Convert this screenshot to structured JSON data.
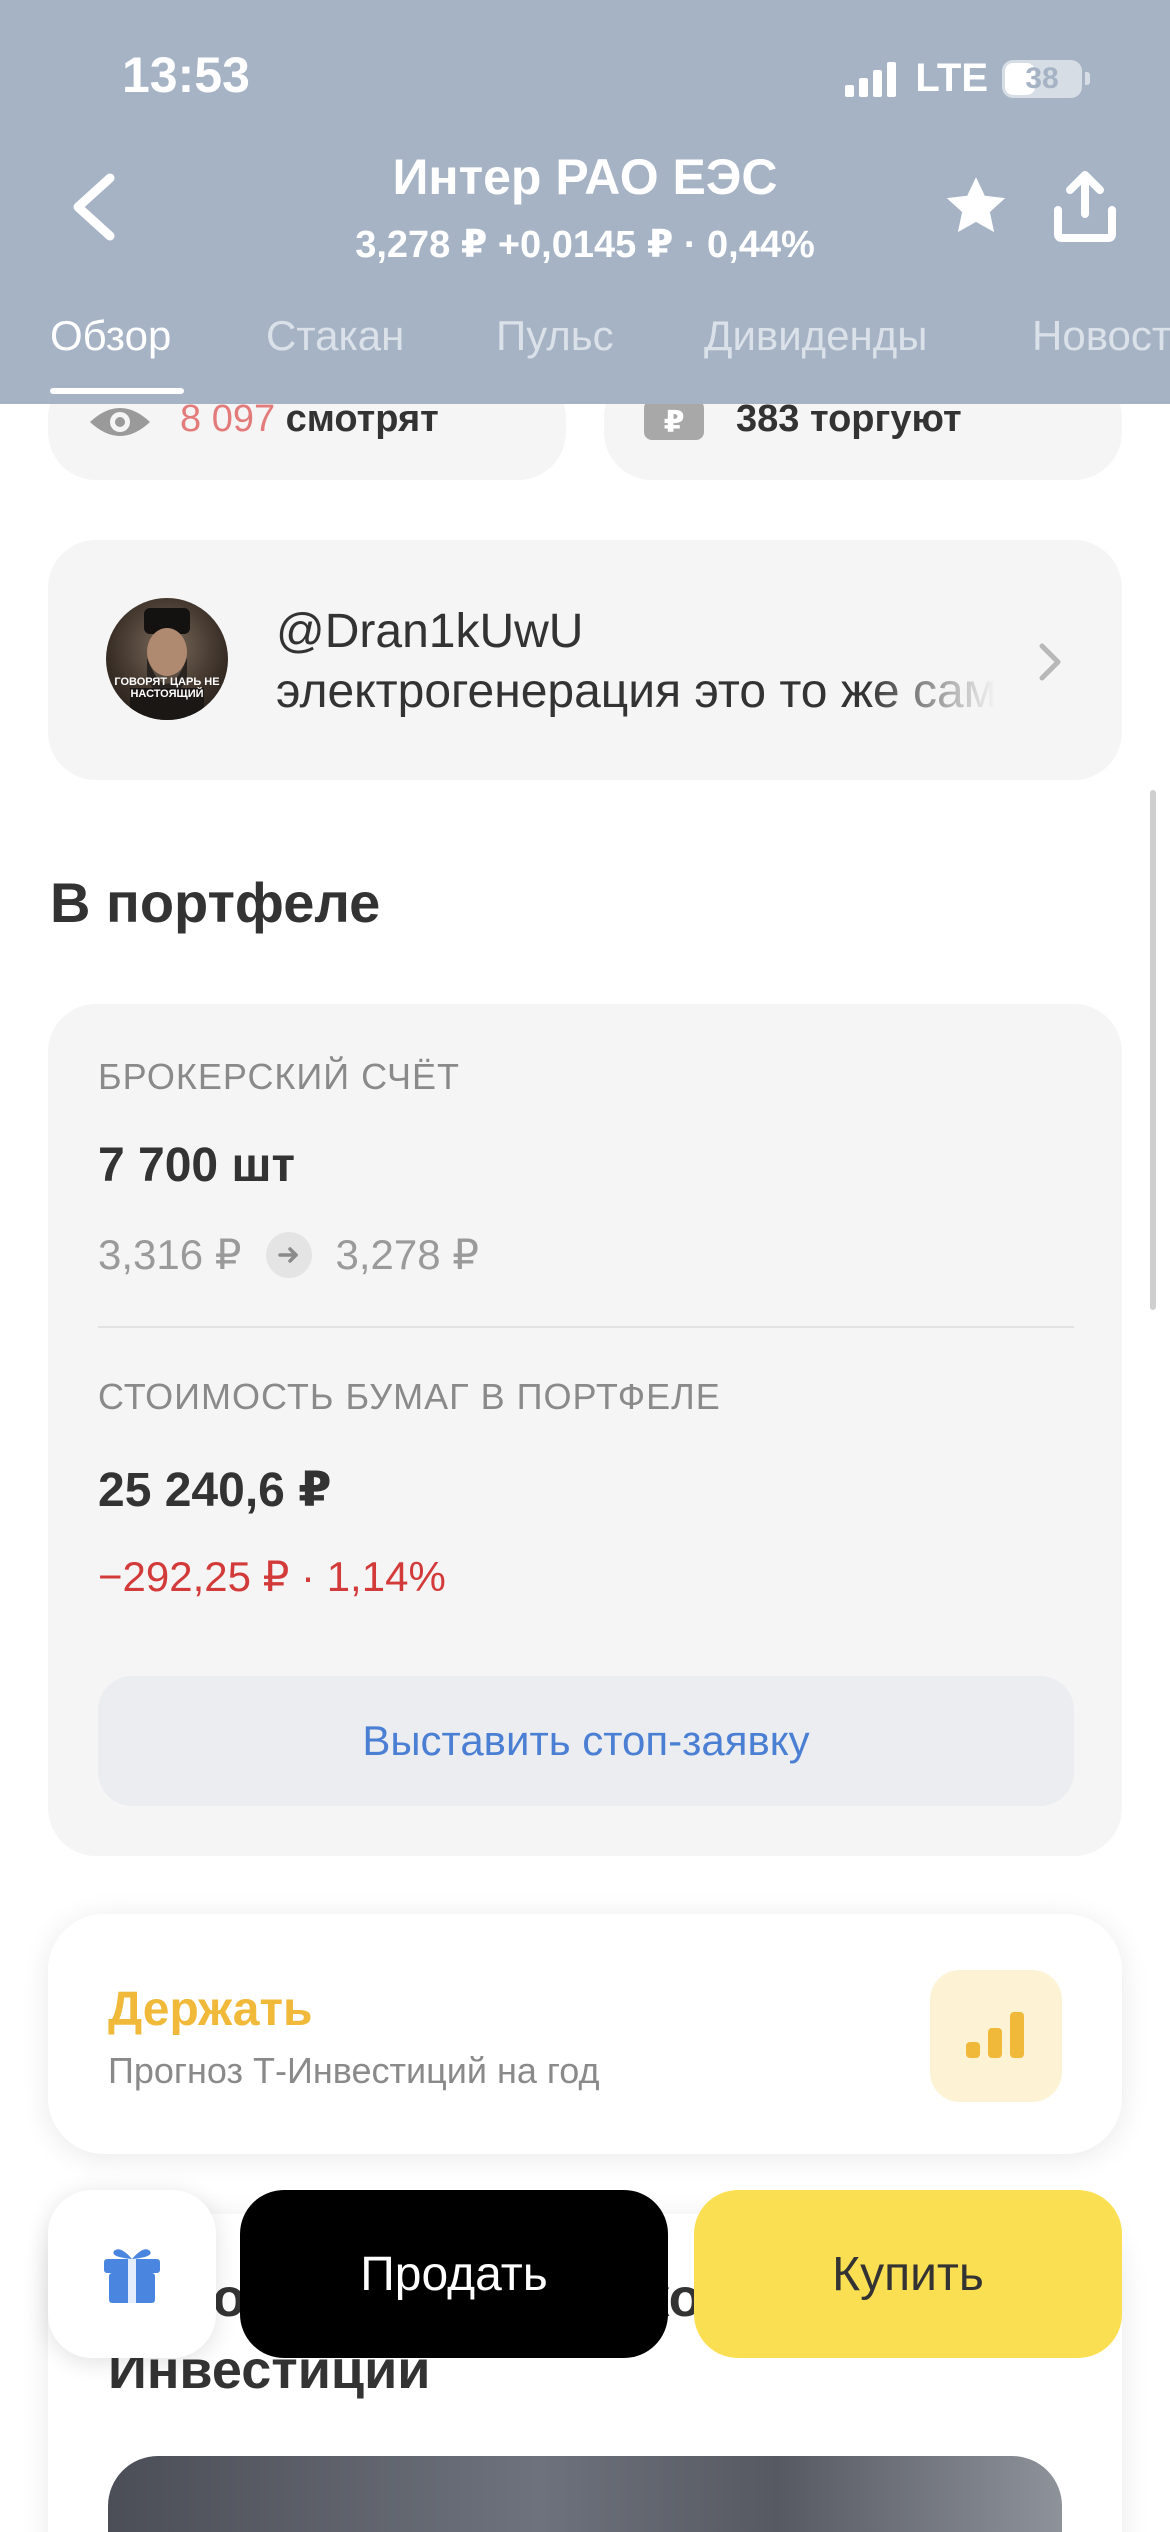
{
  "status_bar": {
    "time": "13:53",
    "network": "LTE",
    "battery": "38"
  },
  "header": {
    "title": "Интер РАО ЕЭС",
    "quote": "3,278 ₽  +0,0145 ₽ · 0,44%",
    "back_icon": "chevron-left-icon",
    "favorite_icon": "star-icon",
    "share_icon": "share-icon"
  },
  "tabs": [
    {
      "label": "Обзор",
      "active": true
    },
    {
      "label": "Стакан",
      "active": false
    },
    {
      "label": "Пульс",
      "active": false
    },
    {
      "label": "Дивиденды",
      "active": false
    },
    {
      "label": "Новости",
      "active": false
    }
  ],
  "stats": {
    "watching_count": "8 097",
    "watching_label": "смотрят",
    "trading_label": "383 торгуют"
  },
  "pulse_post": {
    "username": "@Dran1kUwU",
    "text": "электрогенерация это то же самое",
    "avatar_caption": "ГОВОРЯТ ЦАРЬ НЕ НАСТОЯЩИЙ"
  },
  "portfolio": {
    "section_title": "В портфеле",
    "account_label": "БРОКЕРСКИЙ СЧЁТ",
    "quantity": "7 700 шт",
    "avg_price": "3,316 ₽",
    "current_price": "3,278 ₽",
    "value_label": "СТОИМОСТЬ БУМАГ В ПОРТФЕЛЕ",
    "value": "25 240,6 ₽",
    "change": "−292,25 ₽ · 1,14%",
    "stop_order_button": "Выставить стоп-заявку"
  },
  "forecast": {
    "title": "Держать",
    "subtitle": "Прогноз Т-Инвестиций на год",
    "color": "#f0b93a"
  },
  "news": {
    "title": "Новости от аналитиков Т-Инвестиций"
  },
  "actions": {
    "sell": "Продать",
    "buy": "Купить",
    "buy_color": "#fbdf52"
  }
}
